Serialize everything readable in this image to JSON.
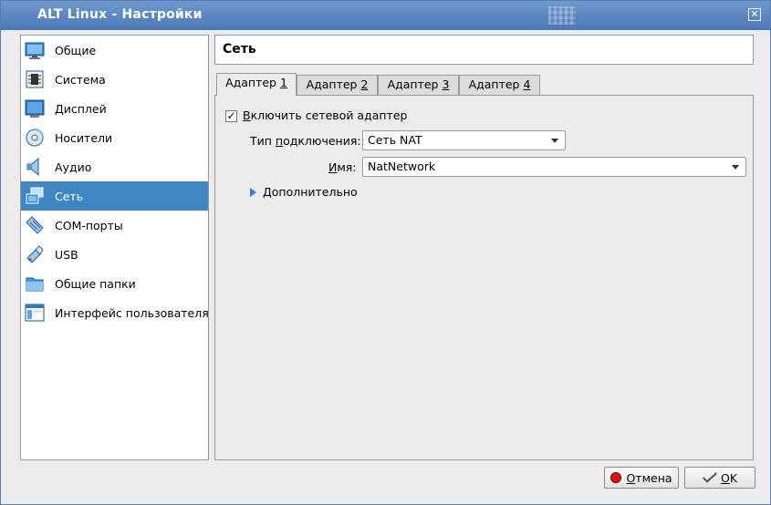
{
  "window": {
    "title": "ALT Linux - Настройки",
    "close_glyph": "✕"
  },
  "colors": {
    "titlebar": "#4a78b4",
    "selection": "#3e86c4",
    "accent_arrow": "#2f7fd3",
    "cancel_red": "#dd1111"
  },
  "sidebar": {
    "items": [
      {
        "label": "Общие",
        "icon": "monitor-icon"
      },
      {
        "label": "Система",
        "icon": "chip-icon"
      },
      {
        "label": "Дисплей",
        "icon": "display-icon"
      },
      {
        "label": "Носители",
        "icon": "disk-icon"
      },
      {
        "label": "Аудио",
        "icon": "speaker-icon"
      },
      {
        "label": "Сеть",
        "icon": "network-icon",
        "selected": true
      },
      {
        "label": "COM-порты",
        "icon": "serial-port-icon"
      },
      {
        "label": "USB",
        "icon": "usb-icon"
      },
      {
        "label": "Общие папки",
        "icon": "folder-icon"
      },
      {
        "label": "Интерфейс пользователя",
        "icon": "ui-window-icon"
      }
    ]
  },
  "page": {
    "title": "Сеть"
  },
  "tabs": [
    {
      "label": "Адаптер ",
      "num": "1",
      "active": true
    },
    {
      "label": "Адаптер ",
      "num": "2"
    },
    {
      "label": "Адаптер ",
      "num": "3"
    },
    {
      "label": "Адаптер ",
      "num": "4"
    }
  ],
  "adapter": {
    "enable_checked_glyph": "✓",
    "enable_prefix": "В",
    "enable_label": "ключить сетевой адаптер",
    "connection_type_label_prefix": "Тип ",
    "connection_type_label_u": "п",
    "connection_type_label_rest": "одключения:",
    "connection_type_value": "Сеть NAT",
    "name_label_u": "И",
    "name_label_rest": "мя:",
    "name_value": "NatNetwork",
    "advanced_u": "Д",
    "advanced_rest": "ополнительно"
  },
  "buttons": {
    "cancel_u": "О",
    "cancel_rest": "тмена",
    "ok_u": "O",
    "ok_rest": "K"
  }
}
